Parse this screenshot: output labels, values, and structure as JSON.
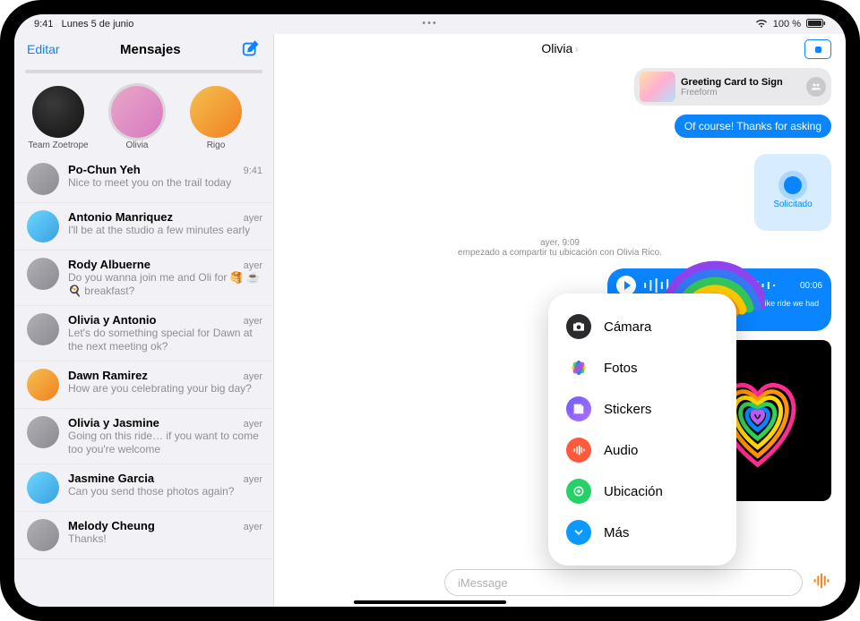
{
  "status": {
    "time": "9:41",
    "date": "Lunes 5 de junio",
    "battery": "100 %"
  },
  "sidebar": {
    "edit": "Editar",
    "title": "Mensajes",
    "pins": [
      {
        "name": "Team Zoetrope"
      },
      {
        "name": "Olivia"
      },
      {
        "name": "Rigo"
      }
    ],
    "rows": [
      {
        "name": "Po-Chun Yeh",
        "time": "9:41",
        "preview": "Nice to meet you on the trail today"
      },
      {
        "name": "Antonio Manriquez",
        "time": "ayer",
        "preview": "I'll be at the studio a few minutes early"
      },
      {
        "name": "Rody Albuerne",
        "time": "ayer",
        "preview": "Do you wanna join me and Oli for 🥞 ☕️ 🍳 breakfast?"
      },
      {
        "name": "Olivia y Antonio",
        "time": "ayer",
        "preview": "Let's do something special for Dawn at the next meeting ok?"
      },
      {
        "name": "Dawn Ramirez",
        "time": "ayer",
        "preview": "How are you celebrating your big day?"
      },
      {
        "name": "Olivia y Jasmine",
        "time": "ayer",
        "preview": "Going on this ride… if you want to come too you're welcome"
      },
      {
        "name": "Jasmine Garcia",
        "time": "ayer",
        "preview": "Can you send those photos again?"
      },
      {
        "name": "Melody Cheung",
        "time": "ayer",
        "preview": "Thanks!"
      }
    ]
  },
  "conversation": {
    "contact": "Olivia",
    "card": {
      "title": "Greeting Card to Sign",
      "subtitle": "Freeform"
    },
    "msg1": "Of course! Thanks for asking",
    "solicited": "Solicitado",
    "timestamp_line1": "ayer, 9:09",
    "timestamp_line2": "empezado a compartir tu ubicación con Olivia Rico.",
    "audio_duration": "00:06",
    "audio_transcript": "Hey Olivia I was just           about what a great bike ride we had to          w proud I am to be your dad",
    "input_placeholder": "iMessage"
  },
  "popover": {
    "items": [
      {
        "label": "Cámara",
        "icon": "camera-icon",
        "bg": "#2b2b2d",
        "fg": "#fff"
      },
      {
        "label": "Fotos",
        "icon": "photos-icon",
        "bg": "",
        "fg": ""
      },
      {
        "label": "Stickers",
        "icon": "stickers-icon",
        "bg": "",
        "fg": ""
      },
      {
        "label": "Audio",
        "icon": "audio-icon",
        "bg": "#ff5a3c",
        "fg": "#fff"
      },
      {
        "label": "Ubicación",
        "icon": "location-icon",
        "bg": "#26d267",
        "fg": "#fff"
      },
      {
        "label": "Más",
        "icon": "more-icon",
        "bg": "#0a9aff",
        "fg": "#fff"
      }
    ]
  }
}
